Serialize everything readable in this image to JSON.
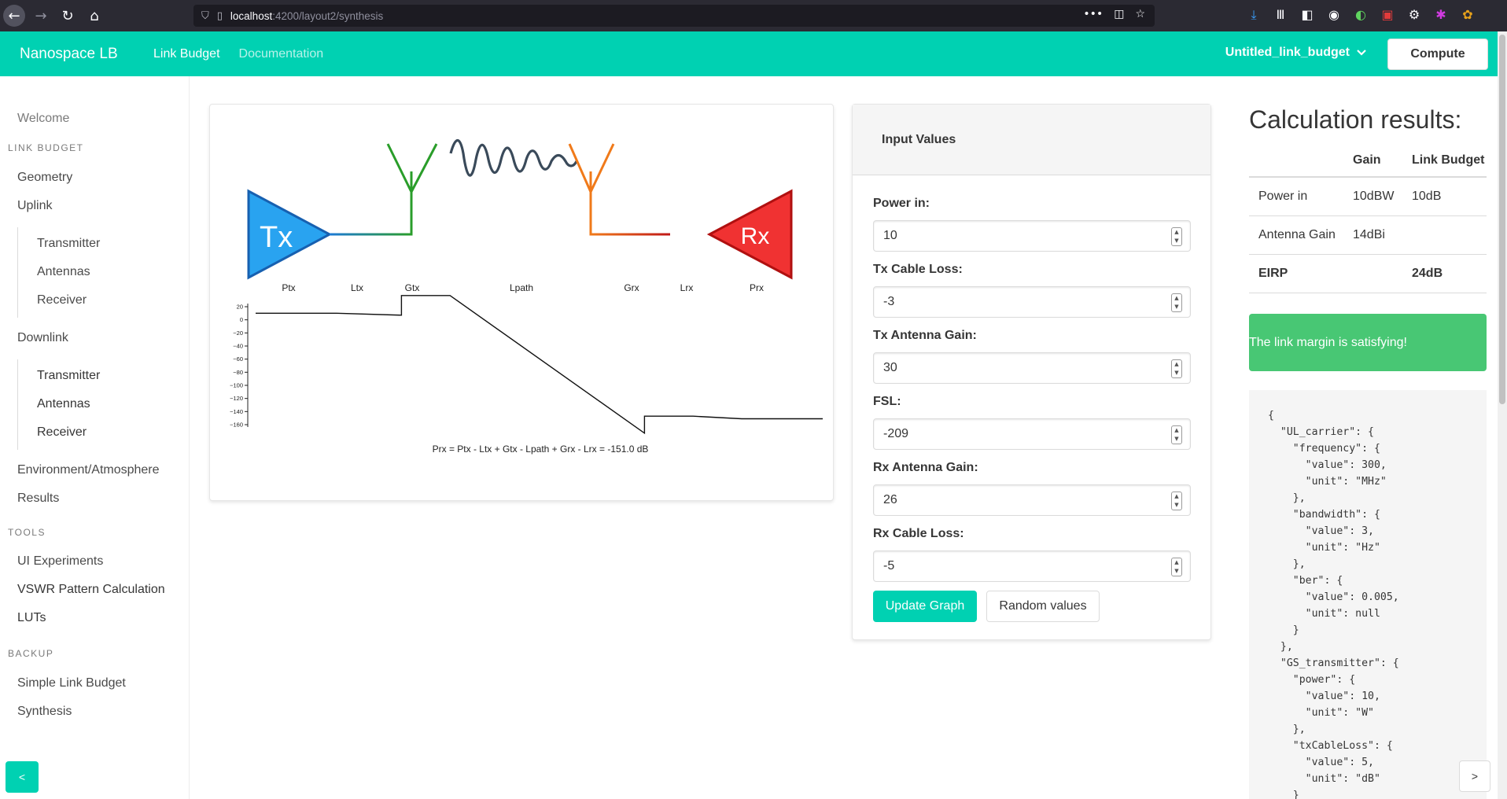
{
  "browser": {
    "url_host": "localhost",
    "url_path": ":4200/layout2/synthesis",
    "url_more": "•••"
  },
  "navbar": {
    "brand": "Nanospace LB",
    "links": [
      "Link Budget",
      "Documentation"
    ],
    "budget_name": "Untitled_link_budget",
    "compute_label": "Compute"
  },
  "sidebar": {
    "welcome": "Welcome",
    "section_link_budget": "LINK BUDGET",
    "geometry": "Geometry",
    "uplink": "Uplink",
    "uplink_items": [
      "Transmitter",
      "Antennas",
      "Receiver"
    ],
    "downlink": "Downlink",
    "downlink_items": [
      "Transmitter",
      "Antennas",
      "Receiver"
    ],
    "environment": "Environment/Atmosphere",
    "results": "Results",
    "section_tools": "TOOLS",
    "tools": [
      "UI Experiments",
      "VSWR Pattern Calculation",
      "LUTs"
    ],
    "section_backup": "BACKUP",
    "backup": [
      "Simple Link Budget",
      "Synthesis"
    ],
    "collapse_label": "<"
  },
  "diagram": {
    "tx_label": "Tx",
    "rx_label": "Rx",
    "stage_labels": [
      "Ptx",
      "Ltx",
      "Gtx",
      "Lpath",
      "Grx",
      "Lrx",
      "Prx"
    ],
    "y_ticks": [
      "20",
      "0",
      "−20",
      "−40",
      "−60",
      "−80",
      "−100",
      "−120",
      "−140",
      "−160"
    ],
    "formula": "Prx = Ptx - Ltx + Gtx - Lpath + Grx - Lrx = -151.0 dB",
    "colors": {
      "tx": "#29a3f0",
      "rx": "#f03232",
      "tx_antenna": "#2a9d2a",
      "rx_antenna": "#f07a1a",
      "wave": "#3a4a5a"
    }
  },
  "chart_data": {
    "type": "line",
    "categories": [
      "Ptx",
      "Ltx",
      "Gtx",
      "Lpath",
      "Grx",
      "Lrx",
      "Prx"
    ],
    "y_ticks": [
      20,
      0,
      -20,
      -40,
      -60,
      -80,
      -100,
      -120,
      -140,
      -160
    ],
    "ylim": [
      -160,
      20
    ],
    "steps": [
      {
        "x": 0,
        "y": 10
      },
      {
        "x": 1,
        "y": 10
      },
      {
        "x": 1.8,
        "y": 7
      },
      {
        "x": 1.8,
        "y": 37
      },
      {
        "x": 2.4,
        "y": 37
      },
      {
        "x": 4.8,
        "y": -173
      },
      {
        "x": 4.8,
        "y": -147
      },
      {
        "x": 5.4,
        "y": -147
      },
      {
        "x": 6,
        "y": -151
      },
      {
        "x": 7,
        "y": -151
      }
    ]
  },
  "inputs": {
    "title": "Input Values",
    "fields": [
      {
        "label": "Power in:",
        "value": "10"
      },
      {
        "label": "Tx Cable Loss:",
        "value": "-3"
      },
      {
        "label": "Tx Antenna Gain:",
        "value": "30"
      },
      {
        "label": "FSL:",
        "value": "-209"
      },
      {
        "label": "Rx Antenna Gain:",
        "value": "26"
      },
      {
        "label": "Rx Cable Loss:",
        "value": "-5"
      }
    ],
    "update_label": "Update Graph",
    "random_label": "Random values"
  },
  "results": {
    "title": "Calculation results:",
    "headers": [
      "",
      "Gain",
      "Link Budget"
    ],
    "rows": [
      [
        "Power in",
        "10dBW",
        "10dB"
      ],
      [
        "Antenna Gain",
        "14dBi",
        ""
      ],
      [
        "EIRP",
        "",
        "24dB"
      ]
    ],
    "notice": "The link margin is satisfying!",
    "json_text": "{\n  \"UL_carrier\": {\n    \"frequency\": {\n      \"value\": 300,\n      \"unit\": \"MHz\"\n    },\n    \"bandwidth\": {\n      \"value\": 3,\n      \"unit\": \"Hz\"\n    },\n    \"ber\": {\n      \"value\": 0.005,\n      \"unit\": null\n    }\n  },\n  \"GS_transmitter\": {\n    \"power\": {\n      \"value\": 10,\n      \"unit\": \"W\"\n    },\n    \"txCableLoss\": {\n      \"value\": 5,\n      \"unit\": \"dB\"\n    }",
    "next_label": ">"
  }
}
